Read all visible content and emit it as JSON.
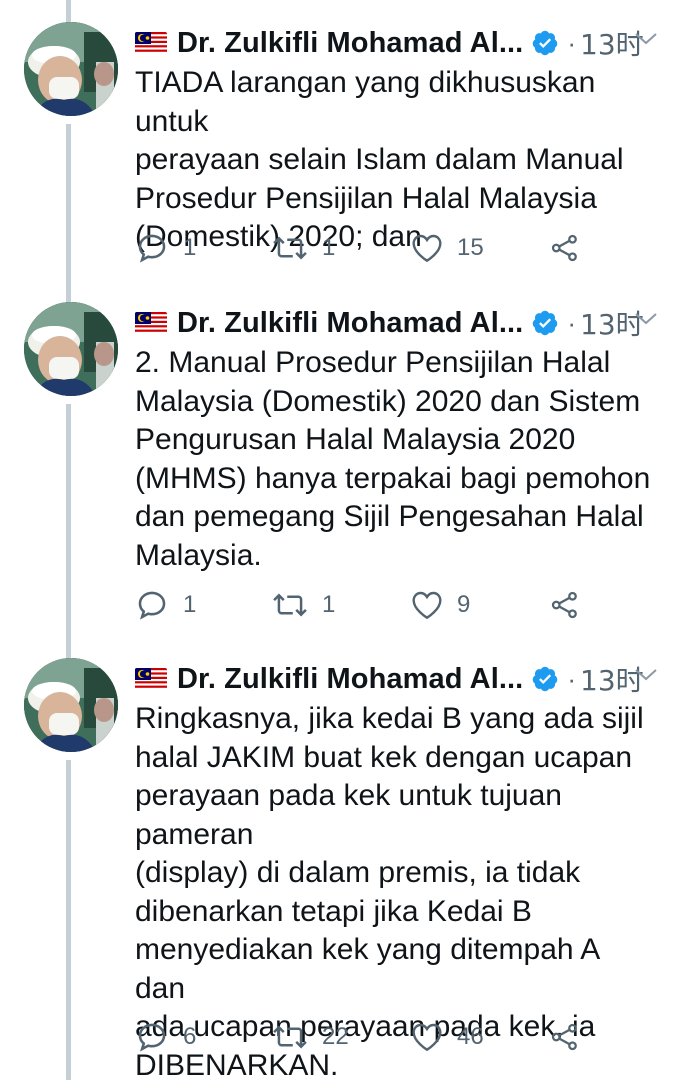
{
  "tweets": [
    {
      "name": "Dr. Zulkifli Mohamad Al...",
      "time": "13时",
      "text": "TIADA larangan yang dikhususkan untuk\nperayaan selain Islam dalam Manual\nProsedur Pensijilan Halal Malaysia\n(Domestik) 2020; dan",
      "replies": "1",
      "retweets": "1",
      "likes": "15"
    },
    {
      "name": "Dr. Zulkifli Mohamad Al...",
      "time": "13时",
      "text": "2. Manual Prosedur Pensijilan Halal\nMalaysia (Domestik) 2020 dan Sistem\nPengurusan Halal Malaysia 2020\n(MHMS) hanya terpakai bagi pemohon\ndan pemegang Sijil Pengesahan Halal\nMalaysia.",
      "replies": "1",
      "retweets": "1",
      "likes": "9"
    },
    {
      "name": "Dr. Zulkifli Mohamad Al...",
      "time": "13时",
      "text": "Ringkasnya, jika kedai B yang ada sijil\nhalal JAKIM buat kek dengan ucapan\nperayaan pada kek untuk tujuan pameran\n(display) di dalam premis, ia tidak\ndibenarkan tetapi jika Kedai B\nmenyediakan kek yang ditempah A dan\nada ucapan perayaan pada kek, ia\nDIBENARKAN.",
      "replies": "6",
      "retweets": "22",
      "likes": "46"
    }
  ],
  "colors": {
    "text": "#0f1419",
    "secondary": "#536471",
    "thread_line": "#c4cfd6",
    "verified": "#1d9bf0"
  },
  "icons": {
    "flag": "malaysia-flag-icon",
    "verified": "verified-badge-icon",
    "caret": "chevron-down-icon",
    "reply": "reply-icon",
    "retweet": "retweet-icon",
    "like": "heart-icon",
    "share": "share-icon"
  }
}
